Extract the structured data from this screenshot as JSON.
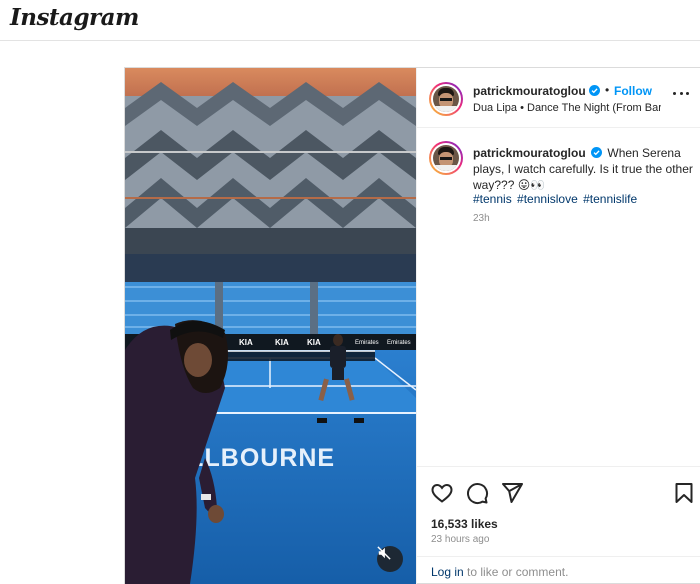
{
  "app": {
    "logo_text": "Instagram"
  },
  "post": {
    "author": "patrickmouratoglou",
    "follow_label": "Follow",
    "separator": "•",
    "audio": "Dua Lipa • Dance The Night (From Bar...",
    "caption": "When Serena plays, I watch carefully. Is it true the other way??? 😛👀",
    "hashtags": [
      "#tennis",
      "#tennislove",
      "#tennislife"
    ],
    "caption_time": "23h",
    "likes": "16,533 likes",
    "posted": "23 hours ago",
    "login_link": "Log in",
    "login_suffix": " to like or comment."
  },
  "media": {
    "court_banner": "MELBOURNE",
    "sponsor_boards": [
      "KIA",
      "KIA",
      "KIA",
      "Emirates",
      "KIA",
      "Emirates"
    ],
    "colors": {
      "court": "#1f6fc0",
      "stands": "#3c8fd6",
      "roof": "#9aa9b7"
    }
  },
  "icons": [
    "heart-icon",
    "comment-icon",
    "share-icon",
    "bookmark-icon",
    "more-icon",
    "mute-icon",
    "verified-icon"
  ]
}
